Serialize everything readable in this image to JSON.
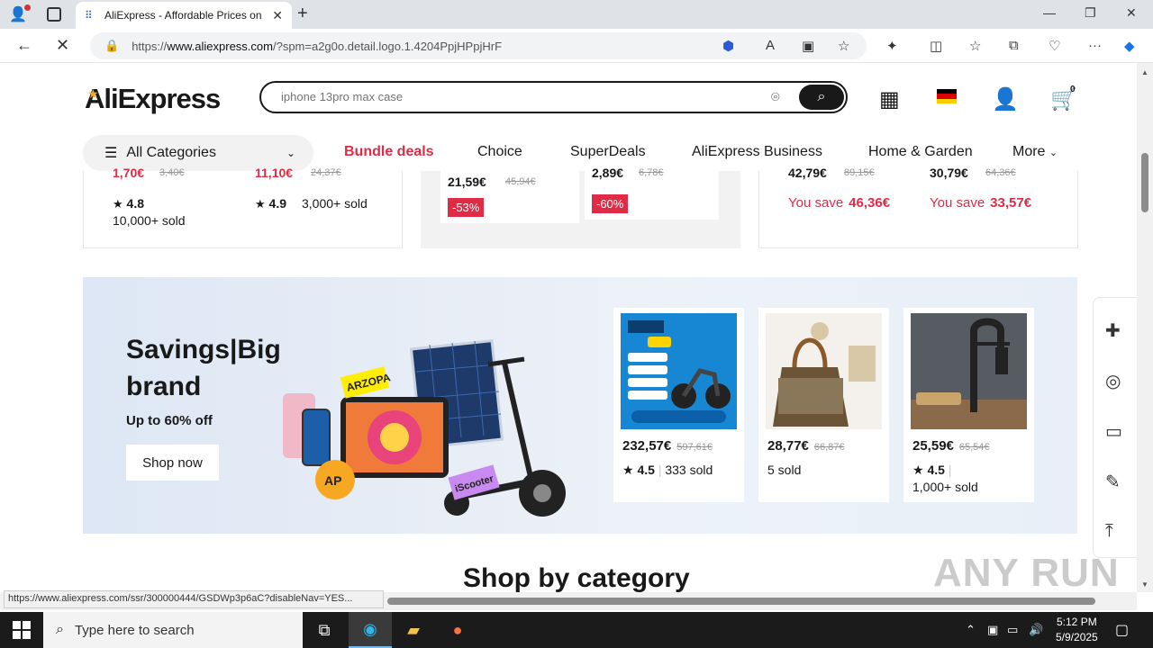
{
  "browser": {
    "tab_title": "AliExpress - Affordable Prices on",
    "url_prefix": "https://",
    "url_host": "www.aliexpress.com",
    "url_path": "/?spm=a2g0o.detail.logo.1.4204PpjHPpjHrF",
    "status_url": "https://www.aliexpress.com/ssr/300000444/GSDWp3p6aC?disableNav=YES..."
  },
  "header": {
    "logo": "AliExpress",
    "search_placeholder": "iphone 13pro max case",
    "cart_count": "0"
  },
  "nav": {
    "all_categories": "All Categories",
    "links": [
      "Bundle deals",
      "Choice",
      "SuperDeals",
      "AliExpress Business",
      "Home & Garden",
      "More"
    ]
  },
  "strip": {
    "left": [
      {
        "price": "1,70€",
        "old": "3,40€",
        "rating": "4.8",
        "sold": "10,000+ sold"
      },
      {
        "price": "11,10€",
        "old": "24,37€",
        "rating": "4.9",
        "sold": "3,000+ sold"
      }
    ],
    "middle": [
      {
        "price": "21,59€",
        "old": "45,94€",
        "pct": "-53%"
      },
      {
        "price": "2,89€",
        "old": "6,78€",
        "pct": "-60%"
      }
    ],
    "right": [
      {
        "price": "42,79€",
        "old": "89,15€",
        "save_label": "You save",
        "save": "46,36€"
      },
      {
        "price": "30,79€",
        "old": "64,36€",
        "save_label": "You save",
        "save": "33,57€"
      }
    ]
  },
  "banner": {
    "title": "Savings|Big brand",
    "subtitle": "Up to 60% off",
    "button": "Shop now",
    "products": [
      {
        "price": "232,57€",
        "old": "597,61€",
        "rating": "4.5",
        "sold": "333 sold"
      },
      {
        "price": "28,77€",
        "old": "66,87€",
        "rating": "",
        "sold": "5 sold"
      },
      {
        "price": "25,59€",
        "old": "65,54€",
        "rating": "4.5",
        "sold": "1,000+ sold"
      }
    ]
  },
  "section_title": "Shop by category",
  "watermark": "ANY RUN",
  "taskbar": {
    "search_placeholder": "Type here to search",
    "time": "5:12 PM",
    "date": "5/9/2025"
  },
  "colors": {
    "accent_red": "#e02b46",
    "brand_star": "#f7a823",
    "banner_bg": "#e9eef6"
  }
}
